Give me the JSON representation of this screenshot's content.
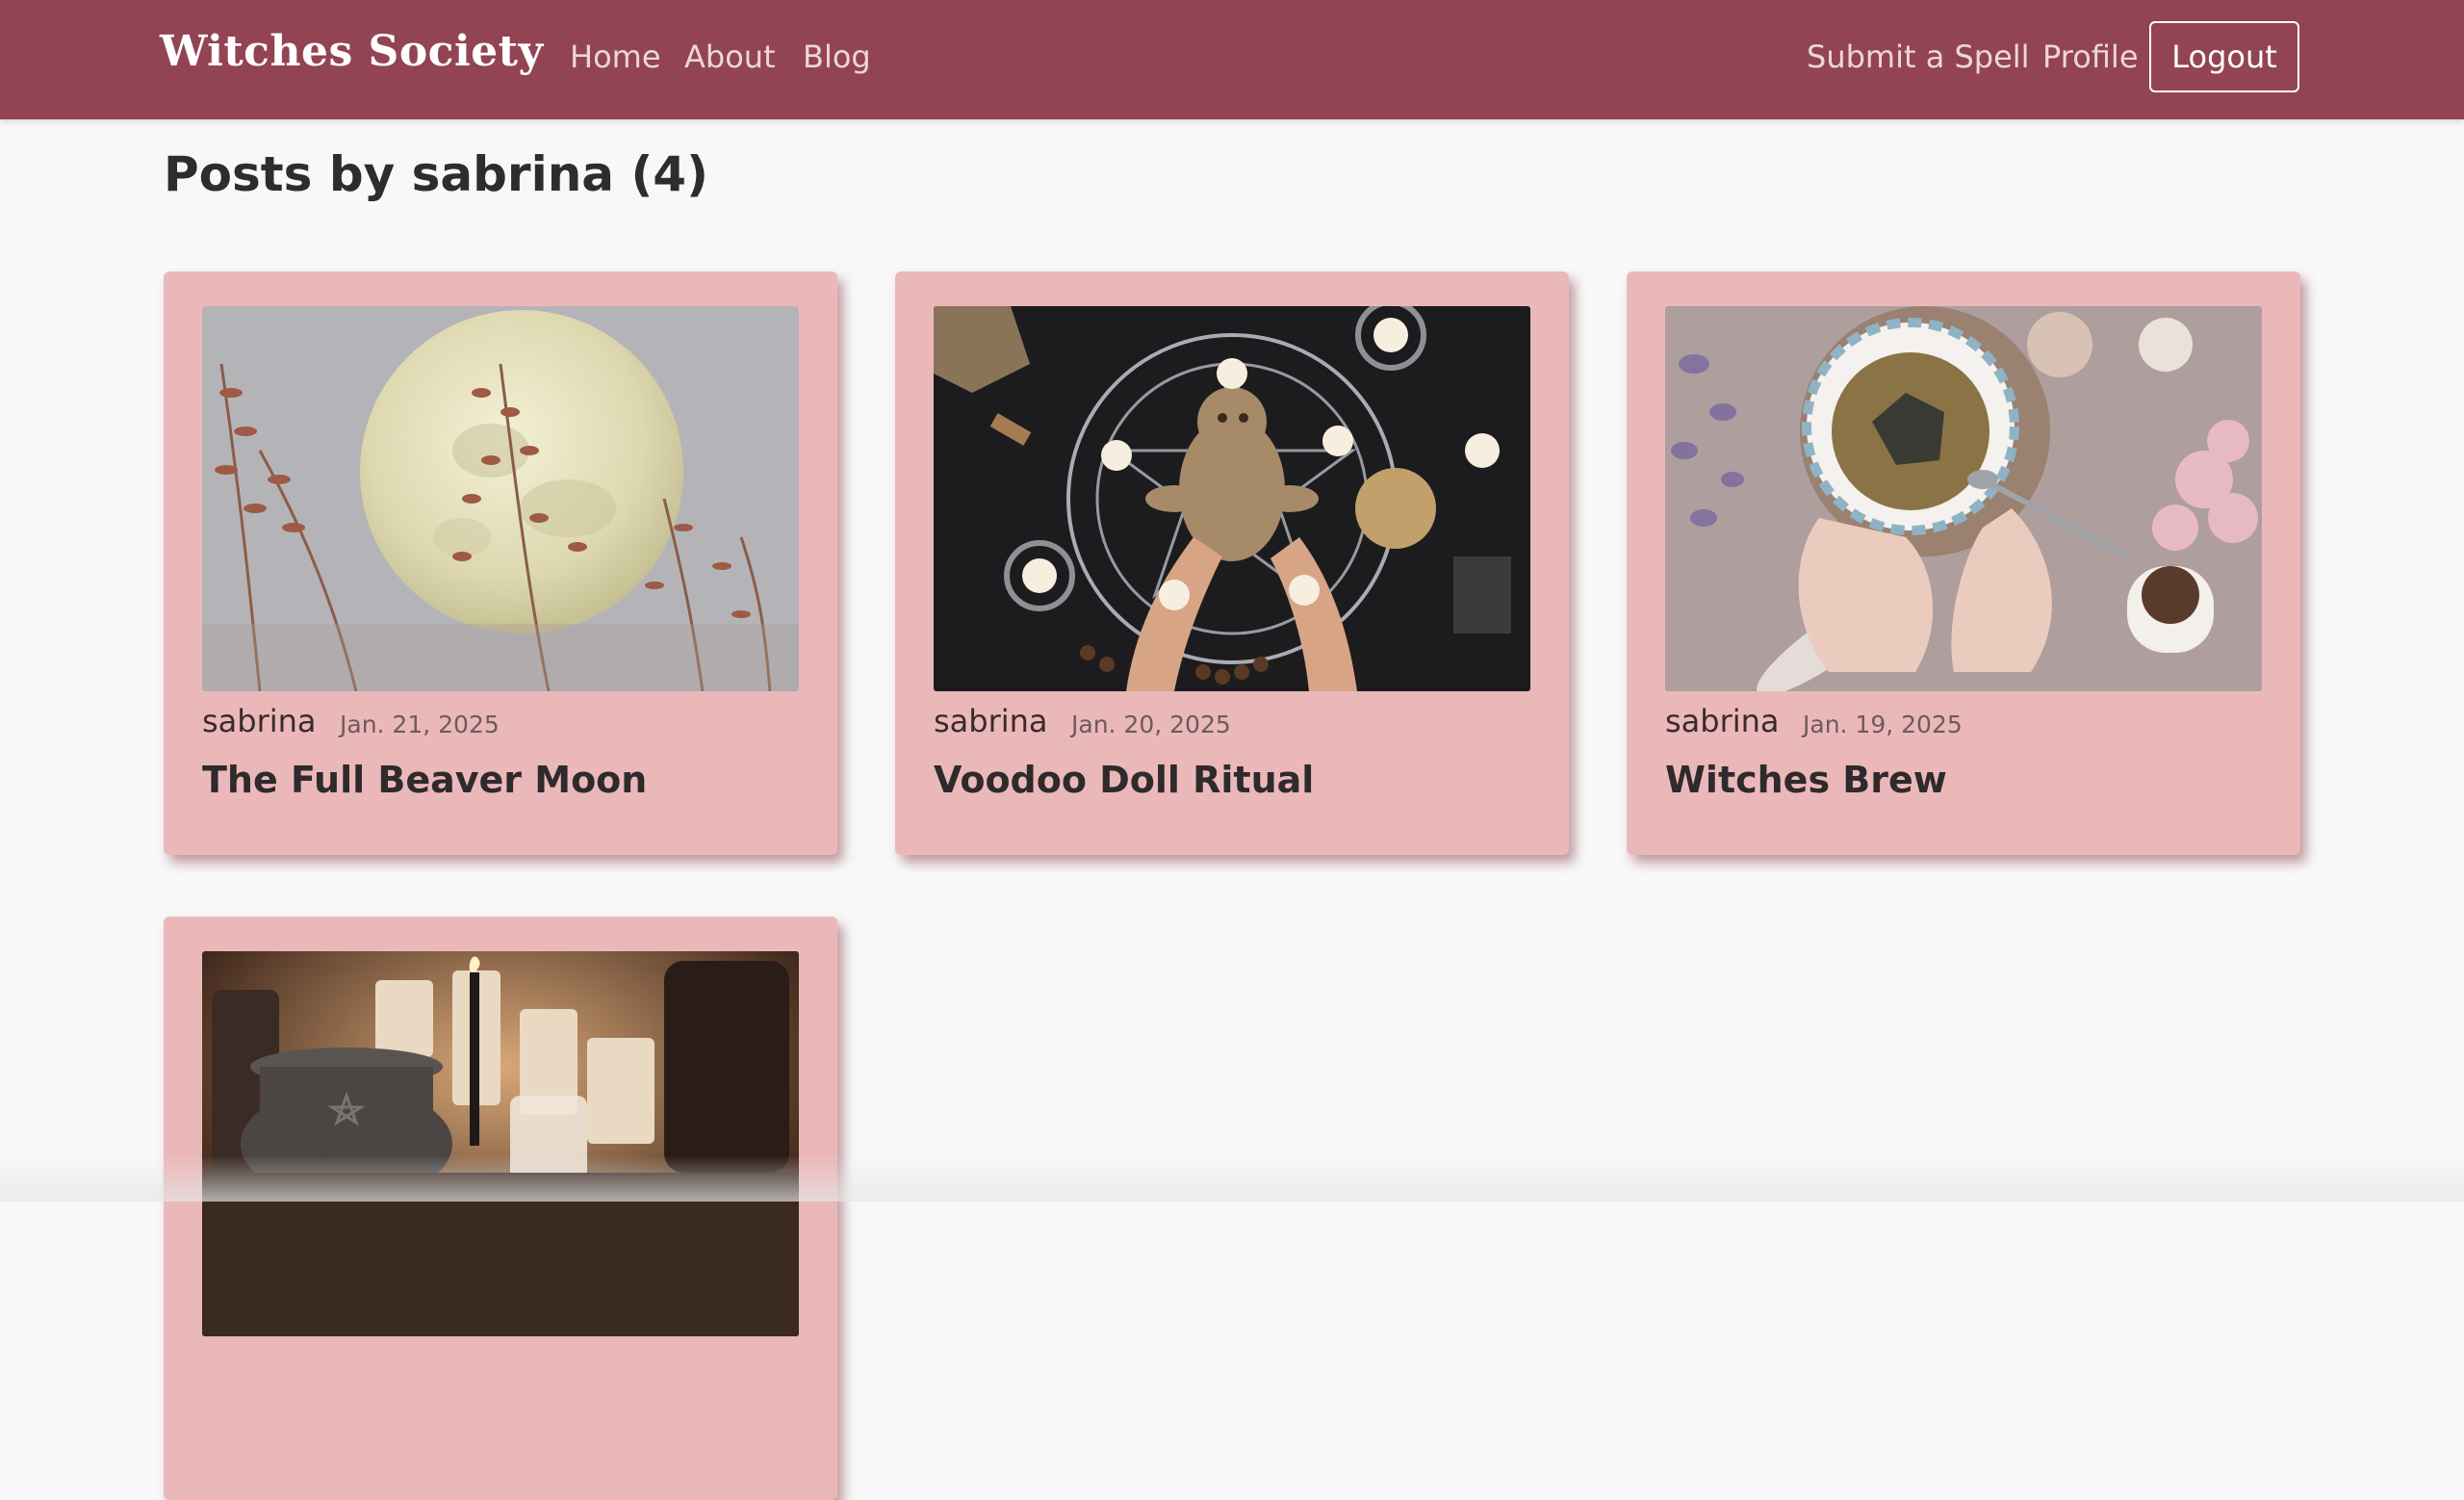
{
  "nav": {
    "brand": "Witches Society",
    "links": [
      "Home",
      "About",
      "Blog"
    ],
    "right_links": [
      "Submit a Spell",
      "Profile"
    ],
    "logout_label": "Logout"
  },
  "page": {
    "title": "Posts by sabrina (4)"
  },
  "posts": [
    {
      "author": "sabrina",
      "date": "Jan. 21, 2025",
      "title": "The Full Beaver Moon",
      "image": "full-moon-grass-image"
    },
    {
      "author": "sabrina",
      "date": "Jan. 20, 2025",
      "title": "Voodoo Doll Ritual",
      "image": "voodoo-doll-altar-image"
    },
    {
      "author": "sabrina",
      "date": "Jan. 19, 2025",
      "title": "Witches Brew",
      "image": "tea-cup-herbs-image"
    },
    {
      "author": "",
      "date": "",
      "title": "",
      "image": "cauldron-candles-image"
    }
  ],
  "colors": {
    "navbar": "#924453",
    "card": "#ebb8ba",
    "background": "#f8f8f8"
  }
}
